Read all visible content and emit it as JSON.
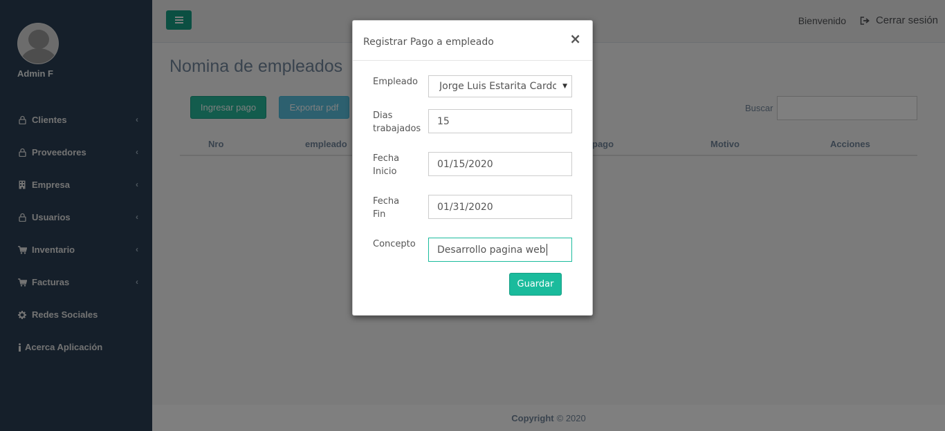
{
  "sidebar": {
    "profile_name": "Admin F",
    "items": [
      {
        "icon": "lock-icon",
        "label": "Clientes",
        "has_submenu": true
      },
      {
        "icon": "lock-icon",
        "label": "Proveedores",
        "has_submenu": true
      },
      {
        "icon": "building-icon",
        "label": "Empresa",
        "has_submenu": true
      },
      {
        "icon": "lock-icon",
        "label": "Usuarios",
        "has_submenu": true
      },
      {
        "icon": "cart-icon",
        "label": "Inventario",
        "has_submenu": true
      },
      {
        "icon": "cart-icon",
        "label": "Facturas",
        "has_submenu": true
      },
      {
        "icon": "gear-icon",
        "label": "Redes Sociales",
        "has_submenu": false
      },
      {
        "icon": "info-icon",
        "label": "Acerca Aplicación",
        "has_submenu": false
      }
    ]
  },
  "header": {
    "welcome": "Bienvenido",
    "logout": "Cerrar sesión"
  },
  "page": {
    "title": "Nomina de empleados",
    "add_button": "Ingresar pago",
    "export_button": "Exportar pdf",
    "search_label": "Buscar",
    "columns": [
      "Nro",
      "empleado",
      "pago",
      "Motivo",
      "Acciones"
    ]
  },
  "footer": {
    "copyright_bold": "Copyright",
    "copyright_rest": "© 2020"
  },
  "modal": {
    "title": "Registrar Pago a empleado",
    "close": "×",
    "fields": {
      "empleado": {
        "label": "Empleado",
        "value": "Jorge Luis Estarita Cardona"
      },
      "dias": {
        "label_line1": "Dias",
        "label_line2": "trabajados",
        "value": "15"
      },
      "fecha_inicio": {
        "label_line1": "Fecha",
        "label_line2": "Inicio",
        "value": "01/15/2020"
      },
      "fecha_fin": {
        "label_line1": "Fecha",
        "label_line2": "Fin",
        "value": "01/31/2020"
      },
      "concepto": {
        "label": "Concepto",
        "value": "Desarrollo pagina web"
      }
    },
    "save_button": "Guardar"
  },
  "colors": {
    "sidebar_bg": "#2A3F54",
    "primary": "#26B99A",
    "info": "#5BC0DE",
    "accent": "#1ABB9C"
  }
}
